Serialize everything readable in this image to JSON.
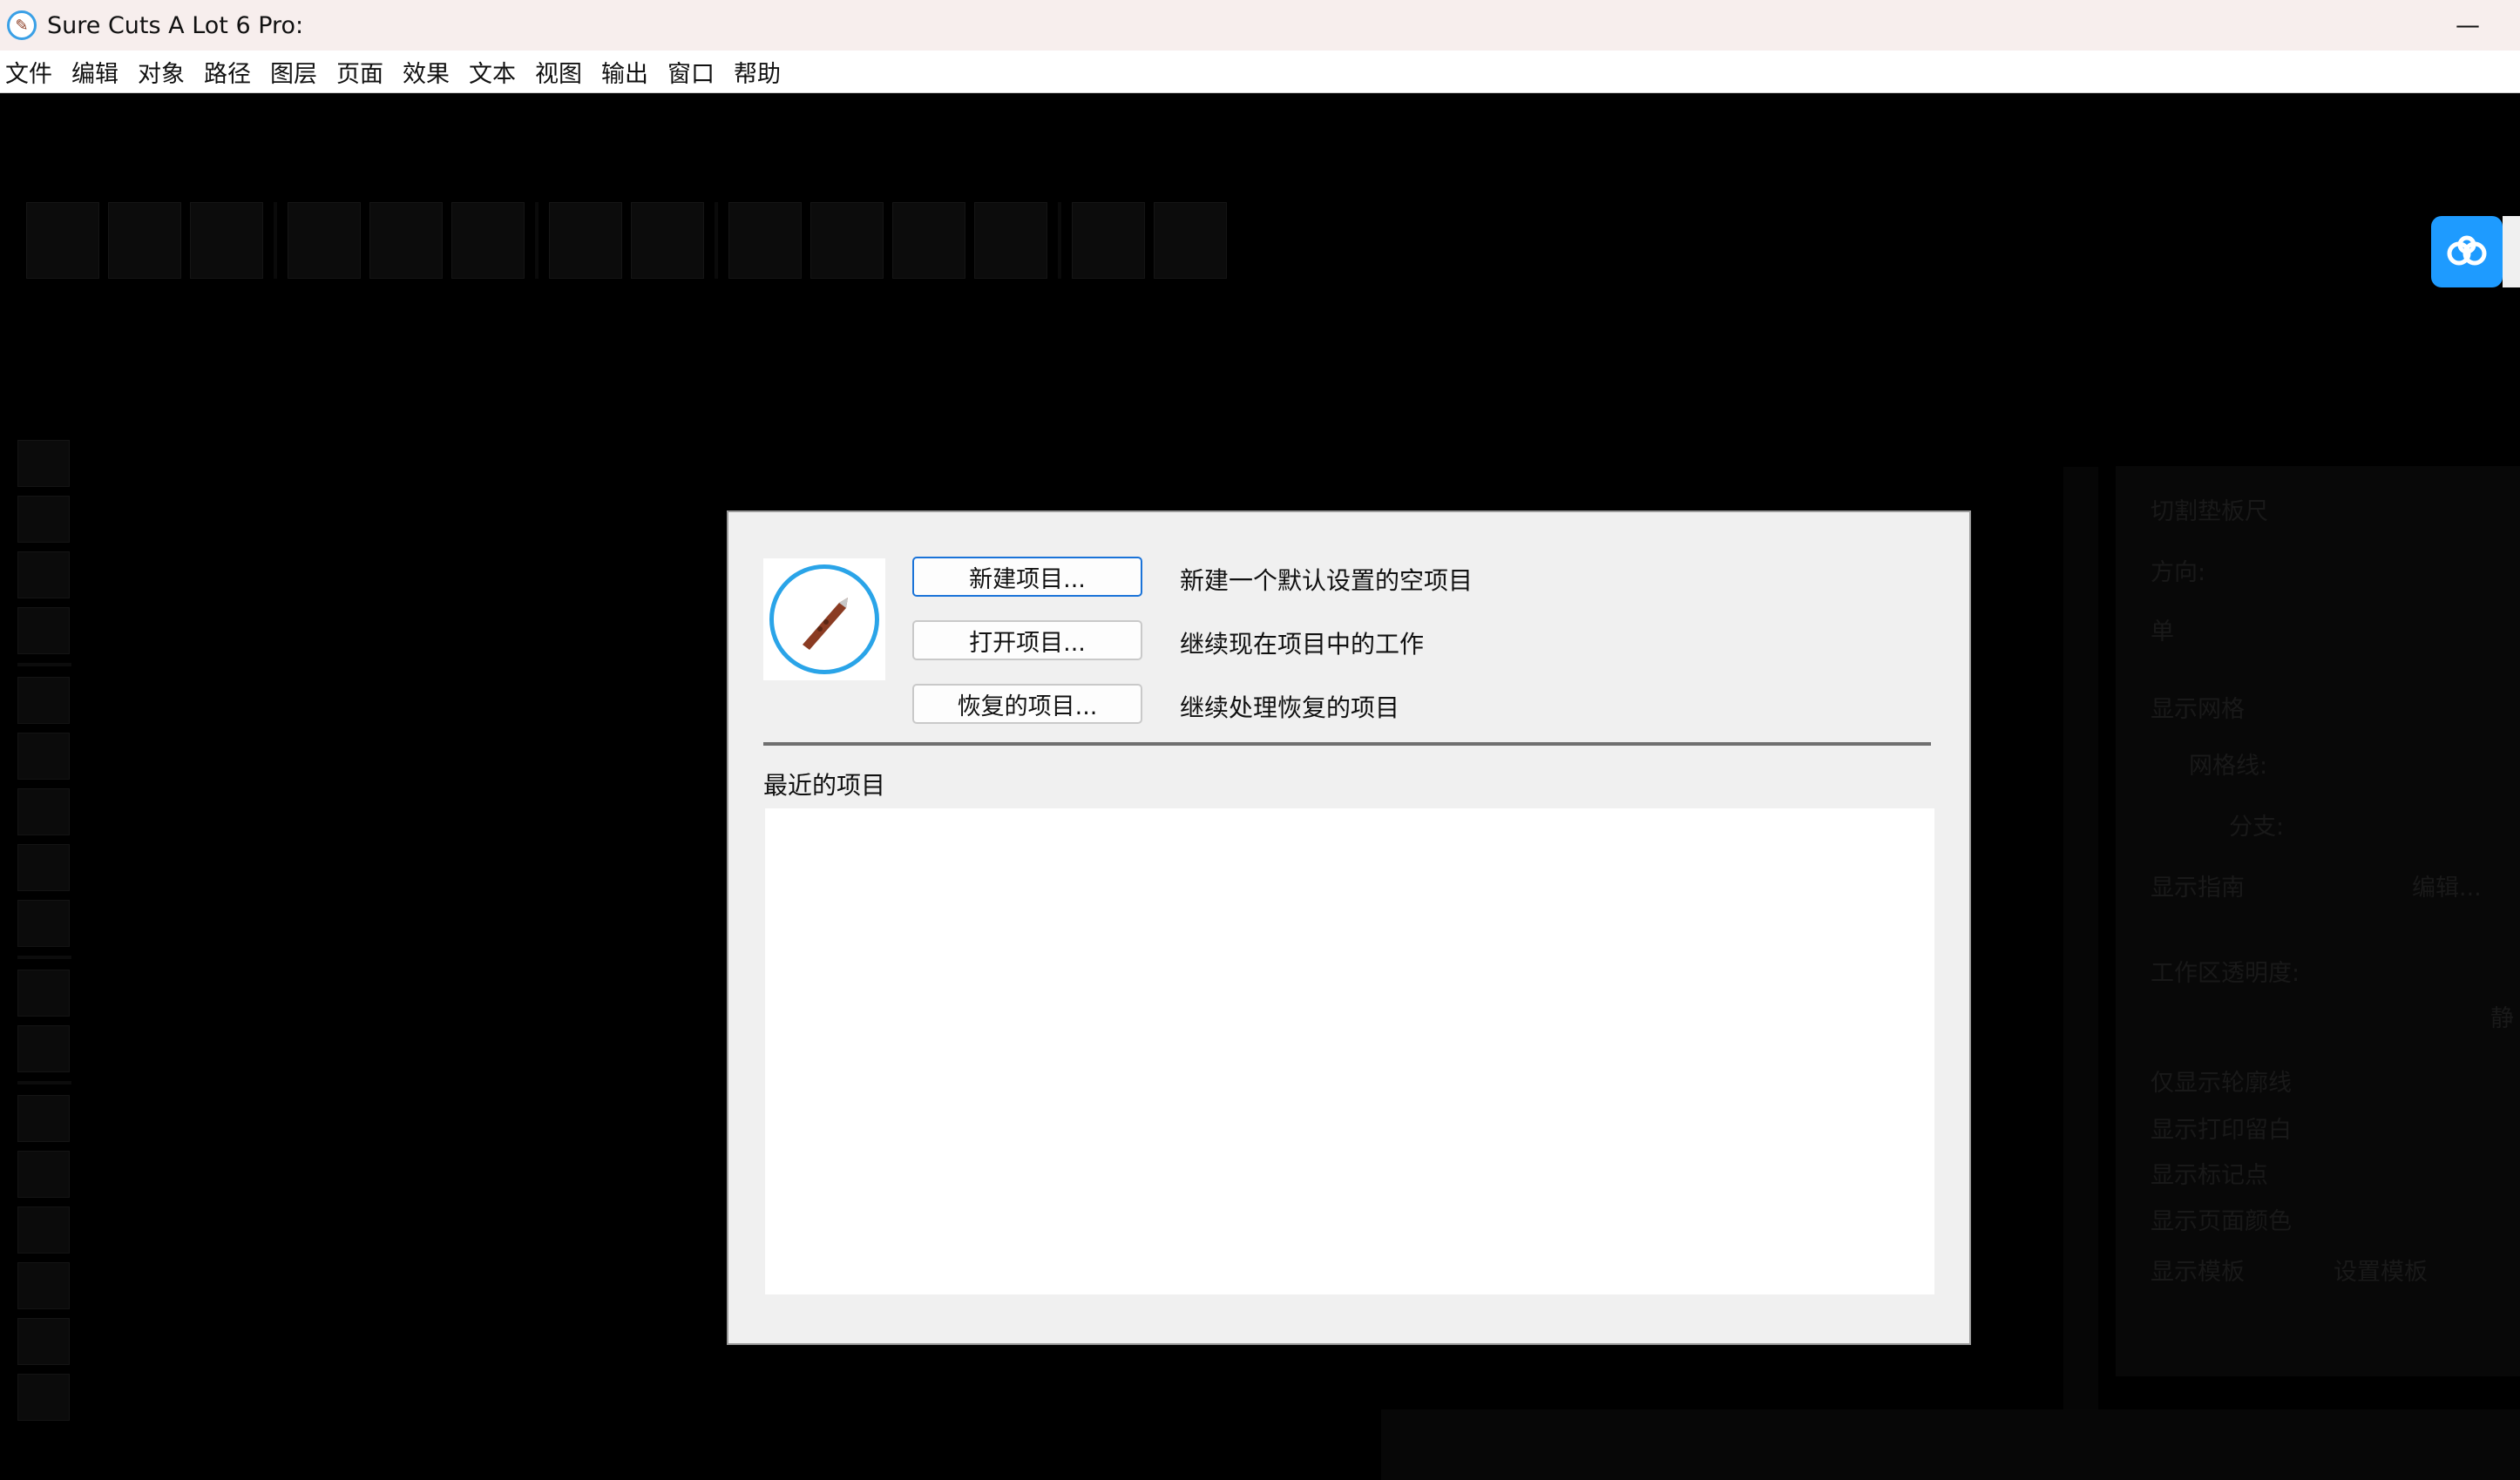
{
  "window": {
    "title": "Sure Cuts A Lot 6 Pro:",
    "minimize_glyph": "—"
  },
  "menubar": {
    "items": [
      "文件",
      "编辑",
      "对象",
      "路径",
      "图层",
      "页面",
      "效果",
      "文本",
      "视图",
      "输出",
      "窗口",
      "帮助"
    ]
  },
  "right_panel": {
    "section_title": "切割垫板尺",
    "direction_label": "方向:",
    "unit_label": "单",
    "show_grid": "显示网格",
    "grid_lines": "网格线:",
    "branch": "分支:",
    "show_guides": "显示指南",
    "edit_button": "编辑...",
    "work_area_opacity": "工作区透明度:",
    "mode_label": "静",
    "only_outline": "仅显示轮廓线",
    "show_print_margin": "显示打印留白",
    "show_marks": "显示标记点",
    "show_page_color": "显示页面颜色",
    "show_template": "显示模板",
    "set_template": "设置模板"
  },
  "dialog": {
    "new_project_button": "新建项目...",
    "new_project_desc": "新建一个默认设置的空项目",
    "open_project_button": "打开项目...",
    "open_project_desc": "继续现在项目中的工作",
    "recovered_project_button": "恢复的项目...",
    "recovered_project_desc": "继续处理恢复的项目",
    "recent_label": "最近的项目"
  },
  "icons": {
    "app": "scal-knife-icon",
    "logo": "scal-knife-logo-icon",
    "cloud": "baidu-netdisk-icon"
  },
  "colors": {
    "title_bar": "#f7eeed",
    "accent": "#1a73d8",
    "cloud": "#1e9bff"
  }
}
